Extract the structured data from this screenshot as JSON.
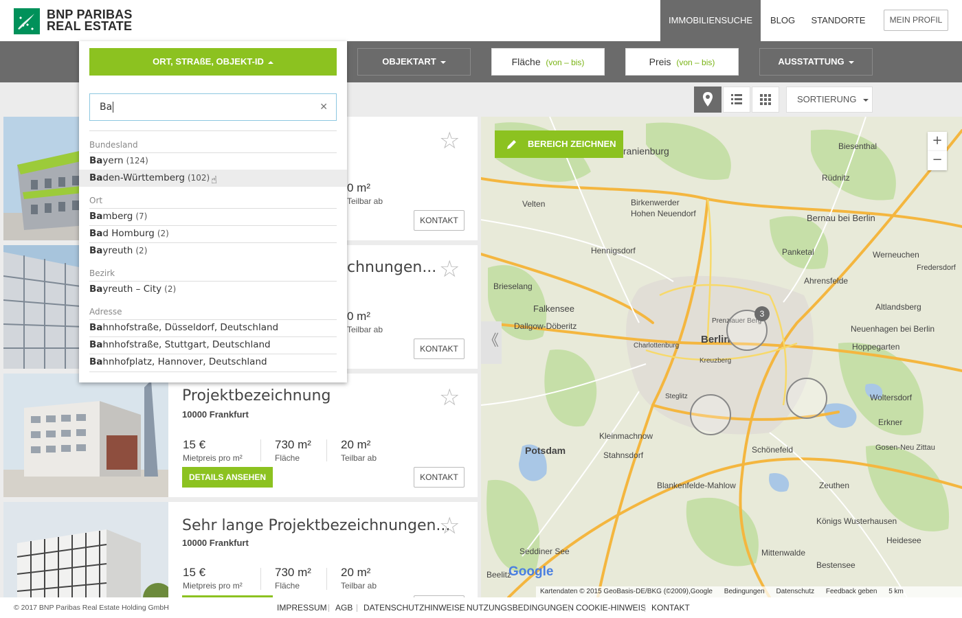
{
  "header": {
    "logo_line1": "BNP PARIBAS",
    "logo_line2": "REAL ESTATE",
    "nav": [
      "IMMOBILIENSUCHE",
      "BLOG",
      "STANDORTE"
    ],
    "profile": "MEIN PROFIL"
  },
  "filters": {
    "location": "ORT, STRAßE, OBJEKT-ID",
    "objektart": "OBJEKTART",
    "flaeche": "Fläche",
    "flaeche_sub": "(von – bis)",
    "preis": "Preis",
    "preis_sub": "(von – bis)",
    "ausstattung": "AUSSTATTUNG"
  },
  "toolbar": {
    "sort": "SORTIERUNG"
  },
  "dropdown": {
    "query": "Ba",
    "groups": [
      {
        "label": "Bundesland",
        "items": [
          {
            "match": "Ba",
            "rest": "yern",
            "count": "(124)"
          },
          {
            "match": "Ba",
            "rest": "den-Württemberg",
            "count": "(102)"
          }
        ]
      },
      {
        "label": "Ort",
        "items": [
          {
            "match": "Ba",
            "rest": "mberg",
            "count": "(7)"
          },
          {
            "match": "Ba",
            "rest": "d Homburg",
            "count": "(2)"
          },
          {
            "match": "Ba",
            "rest": "yreuth",
            "count": "(2)"
          }
        ]
      },
      {
        "label": "Bezirk",
        "items": [
          {
            "match": "Ba",
            "rest": "yreuth – City",
            "count": "(2)"
          }
        ]
      },
      {
        "label": "Adresse",
        "items": [
          {
            "match": "Ba",
            "rest": "hnhofstraße, Düsseldorf, Deutschland",
            "count": ""
          },
          {
            "match": "Ba",
            "rest": "hnhofstraße, Stuttgart, Deutschland",
            "count": ""
          },
          {
            "match": "Ba",
            "rest": "hnhofplatz, Hannover, Deutschland",
            "count": ""
          }
        ]
      }
    ]
  },
  "listings": [
    {
      "title": "",
      "city": "",
      "price": "",
      "price_label": "",
      "area": "",
      "area_label": "",
      "divisible": "0 m²",
      "divisible_label": "Teilbar ab",
      "details": "",
      "contact": "KONTAKT"
    },
    {
      "title": "chnungen...",
      "city": "",
      "price": "",
      "price_label": "",
      "area": "",
      "area_label": "",
      "divisible": "0 m²",
      "divisible_label": "Teilbar ab",
      "details": "",
      "contact": "KONTAKT"
    },
    {
      "title": "Projektbezeichnung",
      "city": "10000 Frankfurt",
      "price": "15 €",
      "price_label": "Mietpreis pro m²",
      "area": "730 m²",
      "area_label": "Fläche",
      "divisible": "20 m²",
      "divisible_label": "Teilbar ab",
      "details": "DETAILS ANSEHEN",
      "contact": "KONTAKT"
    },
    {
      "title": "Sehr lange Projektbezeichnungen...",
      "city": "10000 Frankfurt",
      "price": "15 €",
      "price_label": "Mietpreis pro m²",
      "area": "730 m²",
      "area_label": "Fläche",
      "divisible": "20 m²",
      "divisible_label": "Teilbar ab",
      "details": "",
      "contact": ""
    }
  ],
  "map": {
    "draw_button": "BEREICH ZEICHNEN",
    "zoom_in": "+",
    "zoom_out": "−",
    "cluster_count": "3",
    "labels": [
      "Berlin",
      "Potsdam",
      "Bernau bei Berlin",
      "Falkensee",
      "Hennigsdorf",
      "Velten",
      "Oranienburg",
      "Birkenwerder",
      "Hohen Neuendorf",
      "Kleinmachnow",
      "Stahnsdorf",
      "Schönefeld",
      "Blankenfelde-Mahlow",
      "Königs Wusterhausen",
      "Erkner",
      "Woltersdorf",
      "Neuenhagen bei Berlin",
      "Hoppegarten",
      "Altlandsberg",
      "Ahrensfelde",
      "Panketal",
      "Biesenthal",
      "Rüdnitz",
      "Werneuchen",
      "Zeuthen",
      "Mittenwalde",
      "Heidesee",
      "Bestensee",
      "Seddiner See",
      "Beelitz",
      "Dallgow-Döberitz",
      "Brieselang",
      "Charlottenburg",
      "Kreuzberg",
      "Steglitz",
      "Prenzlauer Berg",
      "Gosen-Neu Zittau",
      "Fredersdorf"
    ],
    "attribution": "Kartendaten © 2015 GeoBasis-DE/BKG (©2009),Google",
    "terms": "Bedingungen",
    "privacy": "Datenschutz",
    "feedback": "Feedback geben",
    "scale": "5 km",
    "google": "Google"
  },
  "footer": {
    "copyright": "© 2017 BNP Paribas Real Estate Holding GmbH",
    "links": [
      "IMPRESSUM",
      "AGB",
      "DATENSCHUTZHINWEISE",
      "NUTZUNGSBEDINGUNGEN",
      "COOKIE-HINWEIS",
      "KONTAKT"
    ]
  },
  "colors": {
    "green": "#8cc220",
    "gray": "#6b6b6b",
    "bnp_green": "#00915a"
  }
}
